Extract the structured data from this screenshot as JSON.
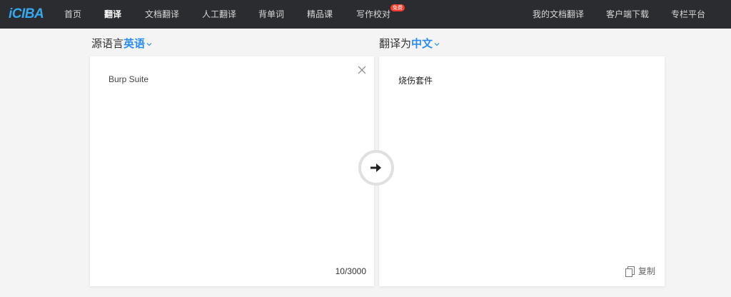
{
  "nav": {
    "logo": "iCIBA",
    "items": [
      "首页",
      "翻译",
      "文档翻译",
      "人工翻译",
      "背单词",
      "精品课",
      "写作校对"
    ],
    "badge": "免费",
    "right_items": [
      "我的文档翻译",
      "客户端下载",
      "专栏平台"
    ]
  },
  "source": {
    "prefix": "源语言",
    "language": "英语",
    "text": "Burp Suite",
    "count": "10/3000"
  },
  "target": {
    "prefix": "翻译为",
    "language": "中文",
    "text": "烧伤套件",
    "copy_label": "复制"
  },
  "colors": {
    "nav_bg": "#2b2c2f",
    "accent": "#2b8cf0",
    "logo": "#35a8f0",
    "badge": "#ff3b2f",
    "page_bg": "#f4f4f4"
  },
  "icons": [
    "close-icon",
    "arrow-right-icon",
    "copy-icon",
    "chevron-down-icon"
  ]
}
